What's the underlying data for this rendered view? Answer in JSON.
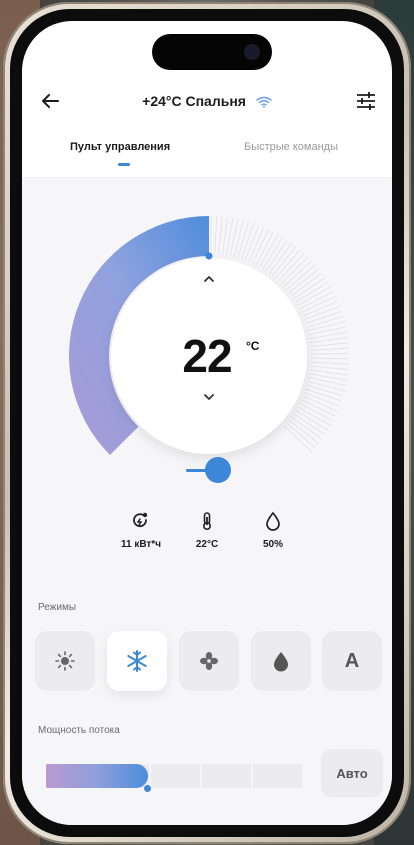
{
  "header": {
    "title": "+24°C Спальня",
    "back_icon": "arrow-left-icon",
    "wifi_icon": "wifi-icon",
    "settings_icon": "sliders-icon"
  },
  "tabs": [
    {
      "label": "Пульт управления",
      "active": true
    },
    {
      "label": "Быстрые команды",
      "active": false
    }
  ],
  "thermostat": {
    "value": "22",
    "unit": "°C",
    "up_icon": "chevron-up-icon",
    "down_icon": "chevron-down-icon",
    "level_fraction": 0.5
  },
  "toggle": {
    "state": "on"
  },
  "stats": [
    {
      "icon": "energy-icon",
      "value": "11 кВт*ч"
    },
    {
      "icon": "thermometer-icon",
      "value": "22°C"
    },
    {
      "icon": "humidity-icon",
      "value": "50%"
    }
  ],
  "modes": {
    "label": "Режимы",
    "items": [
      {
        "icon": "sun-icon",
        "active": false
      },
      {
        "icon": "snowflake-icon",
        "active": true
      },
      {
        "icon": "fan-icon",
        "active": false
      },
      {
        "icon": "drop-icon",
        "active": false
      },
      {
        "icon": "auto-icon",
        "letter": "A",
        "active": false
      }
    ]
  },
  "flow": {
    "label": "Мощность потока",
    "level_fraction": 0.4,
    "auto_label": "Авто"
  },
  "colors": {
    "accent": "#3d86d8",
    "gradient_start": "#b99ad0",
    "gradient_end": "#4c8ddb"
  }
}
